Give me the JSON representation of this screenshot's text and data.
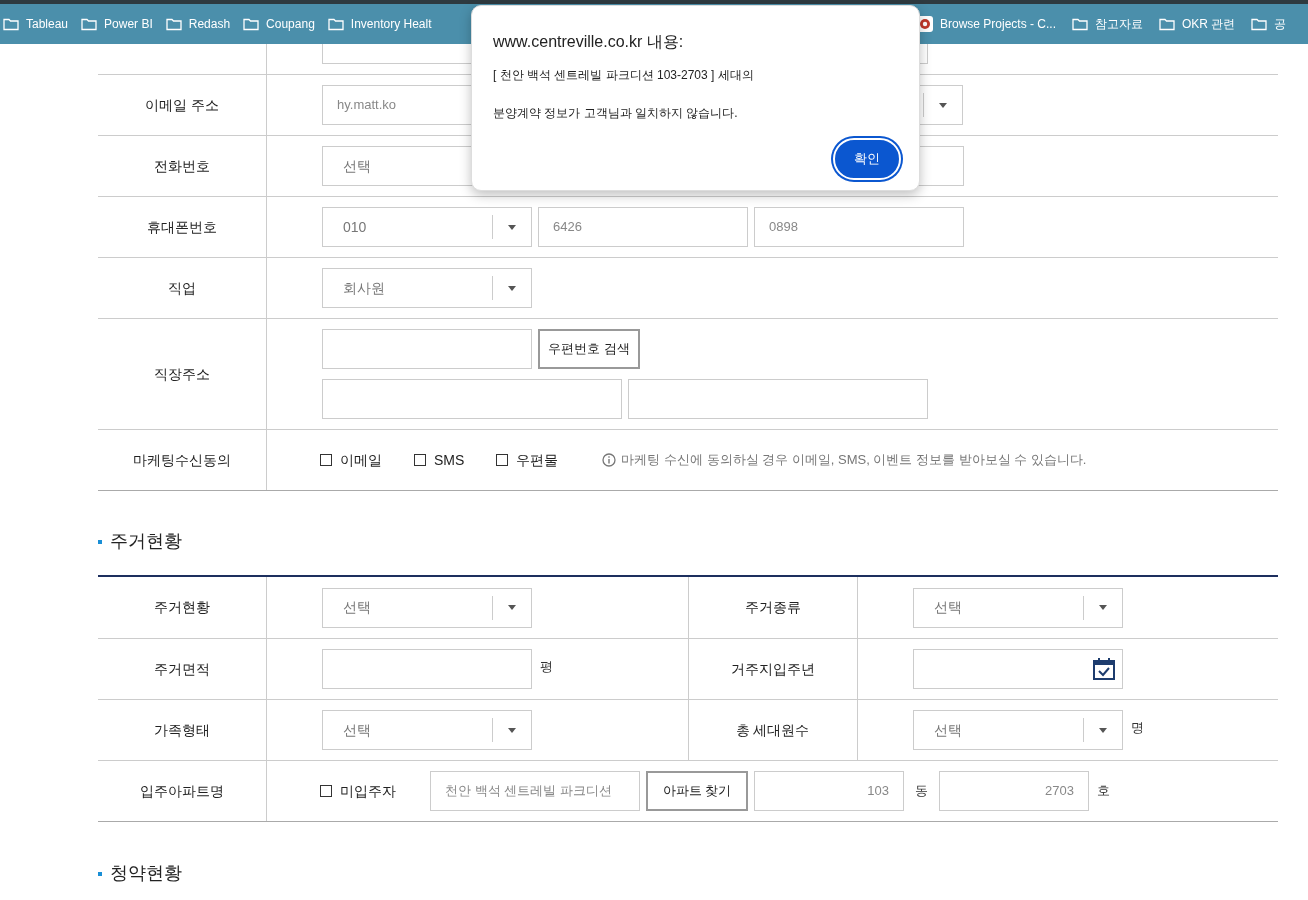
{
  "bookmarks": [
    {
      "label": "Tableau",
      "kind": "folder"
    },
    {
      "label": "Power BI",
      "kind": "folder"
    },
    {
      "label": "Redash",
      "kind": "folder"
    },
    {
      "label": "Coupang",
      "kind": "folder"
    },
    {
      "label": "Inventory Healt",
      "kind": "folder"
    },
    {
      "label": "Browse Projects - C...",
      "kind": "site"
    },
    {
      "label": "참고자료",
      "kind": "folder"
    },
    {
      "label": "OKR 관련",
      "kind": "folder"
    },
    {
      "label": "공",
      "kind": "folder"
    }
  ],
  "dialog": {
    "title": "www.centreville.co.kr 내용:",
    "line1": "[ 천안 백석 센트레빌 파크디션 103-2703 ] 세대의",
    "line2": "분양계약 정보가 고객님과 일치하지 않습니다.",
    "button": "확인"
  },
  "personal": {
    "email": {
      "label": "이메일 주소",
      "id": "hy.matt.ko"
    },
    "phone": {
      "label": "전화번호",
      "prefix": "선택"
    },
    "mobile": {
      "label": "휴대폰번호",
      "prefix": "010",
      "middle": "6426",
      "last": "0898"
    },
    "job": {
      "label": "직업",
      "value": "회사원"
    },
    "work_address": {
      "label": "직장주소",
      "search_button": "우편번호 검색"
    },
    "marketing": {
      "label": "마케팅수신동의",
      "options": [
        {
          "label": "이메일",
          "checked": false
        },
        {
          "label": "SMS",
          "checked": false
        },
        {
          "label": "우편물",
          "checked": false
        }
      ],
      "note": "마케팅 수신에 동의하실 경우 이메일, SMS, 이벤트 정보를 받아보실 수 있습니다."
    }
  },
  "housing": {
    "heading": "주거현황",
    "status": {
      "label": "주거현황",
      "value": "선택"
    },
    "type": {
      "label": "주거종류",
      "value": "선택"
    },
    "area": {
      "label": "주거면적",
      "unit": "평"
    },
    "move_in_year": {
      "label": "거주지입주년"
    },
    "family": {
      "label": "가족형태",
      "value": "선택"
    },
    "household": {
      "label": "총 세대원수",
      "value": "선택",
      "unit": "명"
    },
    "apartment": {
      "label": "입주아파트명",
      "not_moved_in": {
        "label": "미입주자",
        "checked": false
      },
      "name": "천안 백석 센트레빌 파크디션",
      "find_button": "아파트 찾기",
      "dong": "103",
      "dong_unit": "동",
      "ho": "2703",
      "ho_unit": "호"
    }
  },
  "subscription": {
    "heading": "청약현황"
  }
}
